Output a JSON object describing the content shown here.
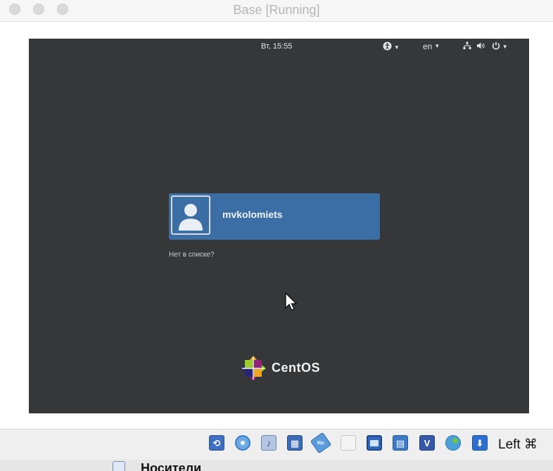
{
  "window": {
    "title": "Base [Running]"
  },
  "vm": {
    "topbar": {
      "clock": "Вт, 15:55",
      "language": "en",
      "icons": [
        "accessibility-icon",
        "network-icon",
        "volume-icon",
        "power-icon"
      ]
    },
    "login": {
      "username": "mvkolomiets",
      "not_listed": "Нет в списке?"
    },
    "logo_text": "CentOS",
    "colors": {
      "background": "#363738",
      "user_row": "#3a6ea5"
    }
  },
  "statusbar": {
    "icons": [
      "storage-icon",
      "optical-disk-icon",
      "audio-icon",
      "network-icon",
      "usb-icon",
      "shared-folder-icon",
      "display-icon",
      "recording-icon",
      "cpu-icon",
      "mouse-integration-icon",
      "keyboard-icon"
    ],
    "host_key": "Left ⌘"
  },
  "bottom": {
    "label": "Носители"
  }
}
